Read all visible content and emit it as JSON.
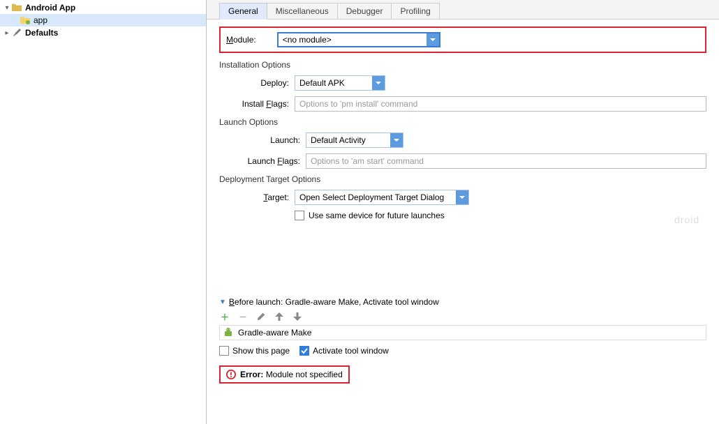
{
  "sidebar": {
    "items": [
      {
        "label": "Android App",
        "type": "folder-open",
        "bold": true
      },
      {
        "label": "app",
        "type": "folder-app",
        "child": true,
        "selected": true
      },
      {
        "label": "Defaults",
        "type": "gear",
        "bold": true
      }
    ]
  },
  "tabs": [
    {
      "label": "General",
      "active": true
    },
    {
      "label": "Miscellaneous"
    },
    {
      "label": "Debugger"
    },
    {
      "label": "Profiling"
    }
  ],
  "module": {
    "label": "Module:",
    "value": "<no module>"
  },
  "installation": {
    "legend": "Installation Options",
    "deploy_label": "Deploy:",
    "deploy_value": "Default APK",
    "install_flags_label": "Install Flags:",
    "install_flags_placeholder": "Options to 'pm install' command"
  },
  "launch": {
    "legend": "Launch Options",
    "launch_label": "Launch:",
    "launch_value": "Default Activity",
    "launch_flags_label": "Launch Flags:",
    "launch_flags_placeholder": "Options to 'am start' command"
  },
  "deployment": {
    "legend": "Deployment Target Options",
    "target_label": "Target:",
    "target_value": "Open Select Deployment Target Dialog",
    "use_same_label": "Use same device for future launches"
  },
  "before_launch": {
    "header": "Before launch: Gradle-aware Make, Activate tool window",
    "list_item": "Gradle-aware Make",
    "show_this_page": "Show this page",
    "activate_tool": "Activate tool window"
  },
  "error": {
    "prefix": "Error:",
    "message": "Module not specified"
  },
  "watermark": "droid"
}
